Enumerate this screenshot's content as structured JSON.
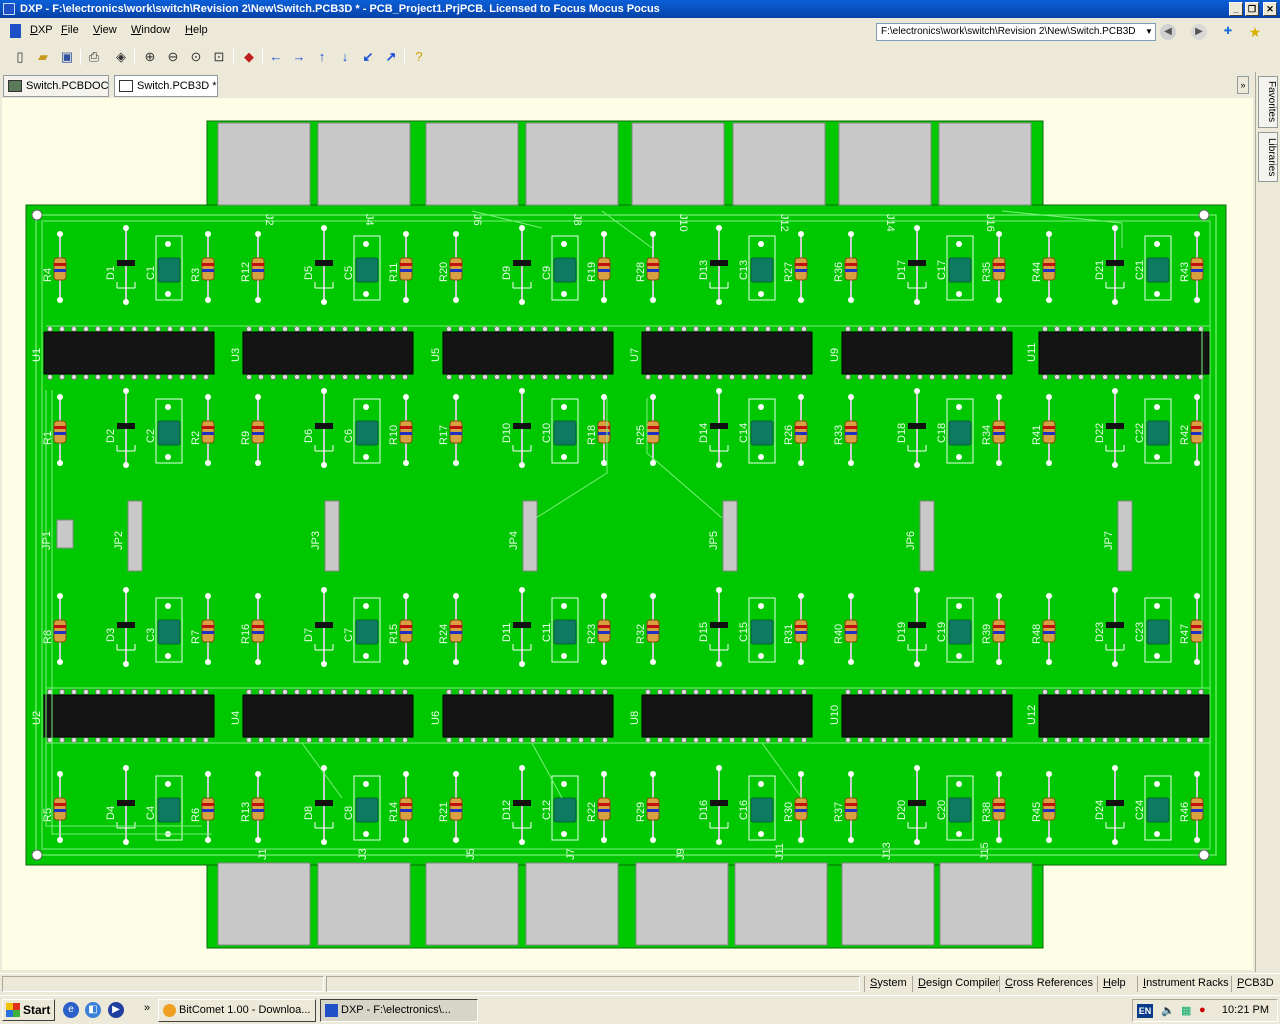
{
  "window": {
    "title": "DXP - F:\\electronics\\work\\switch\\Revision 2\\New\\Switch.PCB3D * - PCB_Project1.PrjPCB. Licensed to Focus Mocus Pocus"
  },
  "menu": [
    "DXP",
    "File",
    "View",
    "Window",
    "Help"
  ],
  "address_bar": {
    "value": "F:\\electronics\\work\\switch\\Revision 2\\New\\Switch.PCB3D"
  },
  "toolbar_icons": [
    "new-icon",
    "open-icon",
    "save-icon",
    "print-icon",
    "layers-icon",
    "zoom-in-icon",
    "zoom-out-icon",
    "zoom-fit-icon",
    "zoom-area-icon",
    "layer-color-icon",
    "arrow-left-icon",
    "arrow-right-icon",
    "arrow-up-icon",
    "arrow-down-icon",
    "arrow-down-left-icon",
    "arrow-up-right-icon",
    "help-icon"
  ],
  "doc_tabs": [
    {
      "label": "Switch.PCBDOC",
      "active": false
    },
    {
      "label": "Switch.PCB3D *",
      "active": true
    }
  ],
  "side_tabs": [
    "Favorites",
    "Libraries"
  ],
  "status_panels": [
    "System",
    "Design Compiler",
    "Cross References",
    "Help",
    "Instrument Racks",
    "PCB3D"
  ],
  "taskbar": {
    "start_label": "Start",
    "tasks": [
      {
        "label": "BitComet 1.00 - Downloa...",
        "active": false
      },
      {
        "label": "DXP - F:\\electronics\\...",
        "active": true
      }
    ],
    "tray": {
      "language": "EN",
      "clock": "10:21 PM"
    }
  },
  "colors": {
    "board": "#00c800",
    "trace": "#7cf07c",
    "chip": "#141414",
    "connector": "#c8c8c8",
    "capacitor": "#0e7a62",
    "title_bar": "#0a5fd8"
  },
  "pcb": {
    "connectors_top": [
      "J2",
      "J4",
      "J6",
      "J8",
      "J10",
      "J12",
      "J14",
      "J16"
    ],
    "connectors_bottom": [
      "J1",
      "J3",
      "J5",
      "J7",
      "J9",
      "J11",
      "J13",
      "J15"
    ],
    "jumpers": [
      "JP1",
      "JP2",
      "JP3",
      "JP4",
      "JP5",
      "JP6",
      "JP7"
    ],
    "chips_row1": [
      "U1",
      "U3",
      "U5",
      "U7",
      "U9",
      "U11"
    ],
    "chips_row2": [
      "U2",
      "U4",
      "U6",
      "U8",
      "U10",
      "U12"
    ],
    "component_rows": [
      [
        "R4",
        "D1",
        "C1",
        "R3",
        "R12",
        "D5",
        "C5",
        "R11",
        "R20",
        "D9",
        "C9",
        "R19",
        "R28",
        "D13",
        "C13",
        "R27",
        "R36",
        "D17",
        "C17",
        "R35",
        "R44",
        "D21",
        "C21",
        "R43"
      ],
      [
        "R1",
        "D2",
        "C2",
        "R2",
        "R9",
        "D6",
        "C6",
        "R10",
        "R17",
        "D10",
        "C10",
        "R18",
        "R25",
        "D14",
        "C14",
        "R26",
        "R33",
        "D18",
        "C18",
        "R34",
        "R41",
        "D22",
        "C22",
        "R42"
      ],
      [
        "R8",
        "D3",
        "C3",
        "R7",
        "R16",
        "D7",
        "C7",
        "R15",
        "R24",
        "D11",
        "C11",
        "R23",
        "R32",
        "D15",
        "C15",
        "R31",
        "R40",
        "D19",
        "C19",
        "R39",
        "R48",
        "D23",
        "C23",
        "R47"
      ],
      [
        "R5",
        "D4",
        "C4",
        "R6",
        "R13",
        "D8",
        "C8",
        "R14",
        "R21",
        "D12",
        "C12",
        "R22",
        "R29",
        "D16",
        "C16",
        "R30",
        "R37",
        "D20",
        "C20",
        "R38",
        "R45",
        "D24",
        "C24",
        "R46"
      ]
    ]
  }
}
